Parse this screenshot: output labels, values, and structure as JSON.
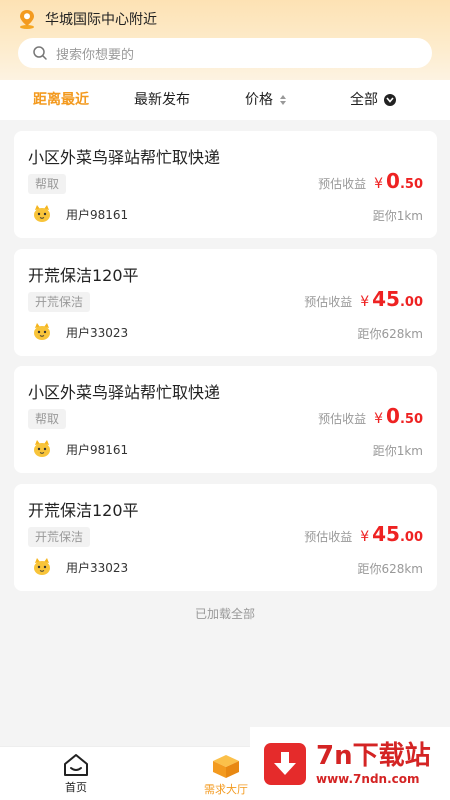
{
  "header": {
    "location": "华城国际中心附近",
    "location_icon": "location-pin-icon",
    "search_placeholder": "搜索你想要的"
  },
  "filters": [
    {
      "label": "距离最近",
      "active": true
    },
    {
      "label": "最新发布",
      "active": false
    },
    {
      "label": "价格",
      "active": false,
      "icon": "sort-arrows-icon"
    },
    {
      "label": "全部",
      "active": false,
      "icon": "chevron-down-icon"
    }
  ],
  "cards": [
    {
      "title": "小区外菜鸟驿站帮忙取快递",
      "tag": "帮取",
      "income_label": "预估收益",
      "currency": "¥",
      "price_int": "0",
      "price_dec": ".50",
      "user": "用户98161",
      "distance": "距你1km"
    },
    {
      "title": "开荒保洁120平",
      "tag": "开荒保洁",
      "income_label": "预估收益",
      "currency": "¥",
      "price_int": "45",
      "price_dec": ".00",
      "user": "用户33023",
      "distance": "距你628km"
    },
    {
      "title": "小区外菜鸟驿站帮忙取快递",
      "tag": "帮取",
      "income_label": "预估收益",
      "currency": "¥",
      "price_int": "0",
      "price_dec": ".50",
      "user": "用户98161",
      "distance": "距你1km"
    },
    {
      "title": "开荒保洁120平",
      "tag": "开荒保洁",
      "income_label": "预估收益",
      "currency": "¥",
      "price_int": "45",
      "price_dec": ".00",
      "user": "用户33023",
      "distance": "距你628km"
    }
  ],
  "list_footer": "已加载全部",
  "tabbar": {
    "home_label": "首页",
    "home_icon": "home-icon",
    "need_label": "需求大厅",
    "need_icon": "box-icon"
  },
  "watermark": {
    "title": "7n下载站",
    "url": "www.7ndn.com",
    "icon": "download-arrow-icon"
  },
  "colors": {
    "accent": "#f39a1f",
    "price": "#e22222",
    "watermark": "#d42424"
  }
}
